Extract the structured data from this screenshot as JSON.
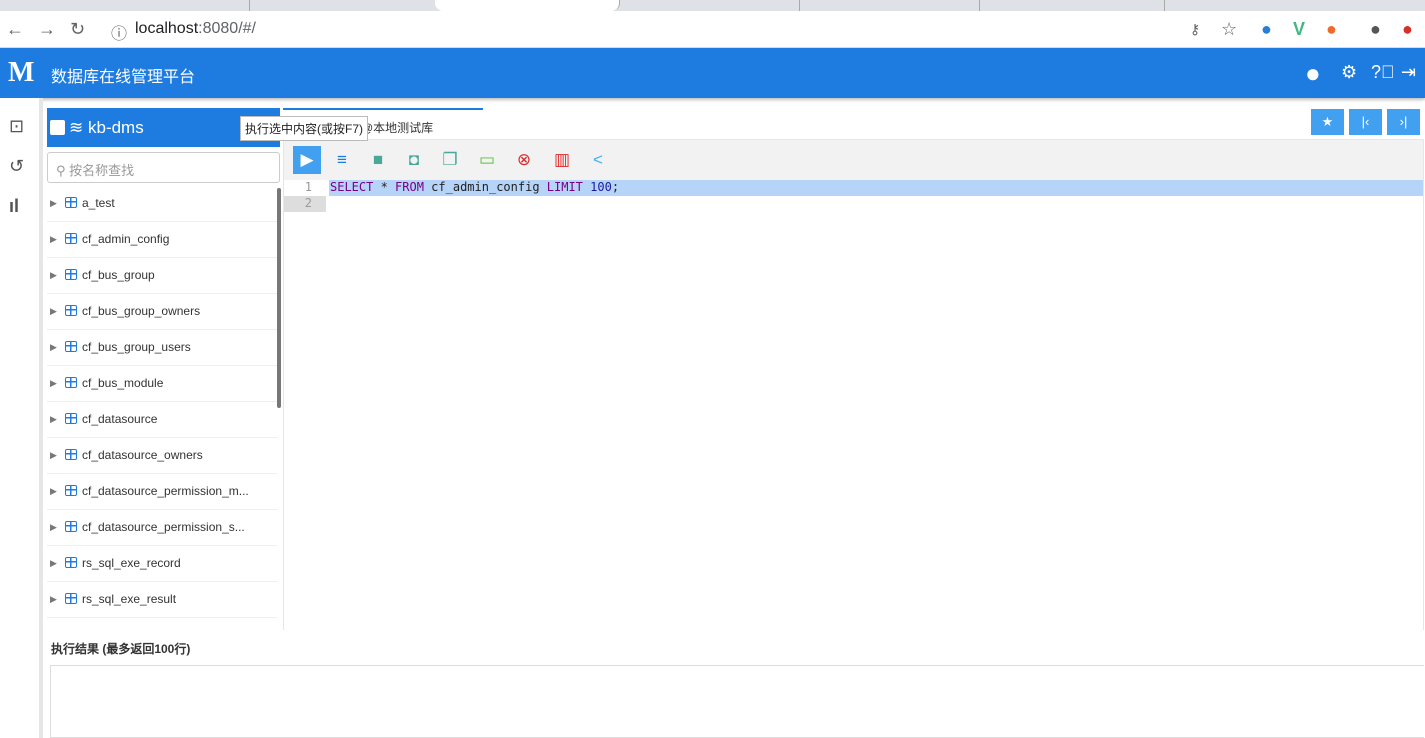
{
  "browser": {
    "url_host": "localhost",
    "url_rest": ":8080/#/"
  },
  "header": {
    "logo": "M",
    "title": "数据库在线管理平台"
  },
  "sidebar": {
    "db_name": "kb-dms",
    "search_placeholder": "按名称查找",
    "tables": [
      "a_test",
      "cf_admin_config",
      "cf_bus_group",
      "cf_bus_group_owners",
      "cf_bus_group_users",
      "cf_bus_module",
      "cf_datasource",
      "cf_datasource_owners",
      "cf_datasource_permission_m...",
      "cf_datasource_permission_s...",
      "rs_sql_exe_record",
      "rs_sql_exe_result"
    ]
  },
  "tooltip": "执行选中内容(或按F7)",
  "editor": {
    "tab_label": "@本地测试库",
    "sql": {
      "k1": "SELECT",
      "t1": " * ",
      "k2": "FROM",
      "t2": " cf_admin_config ",
      "k3": "LIMIT",
      "t3": " ",
      "n": "100",
      "t4": ";"
    },
    "line_numbers": [
      "1",
      "2"
    ]
  },
  "result": {
    "label": "执行结果 (最多返回100行)"
  },
  "colors": {
    "brand": "#1e7ce0",
    "button": "#42a0f0"
  }
}
